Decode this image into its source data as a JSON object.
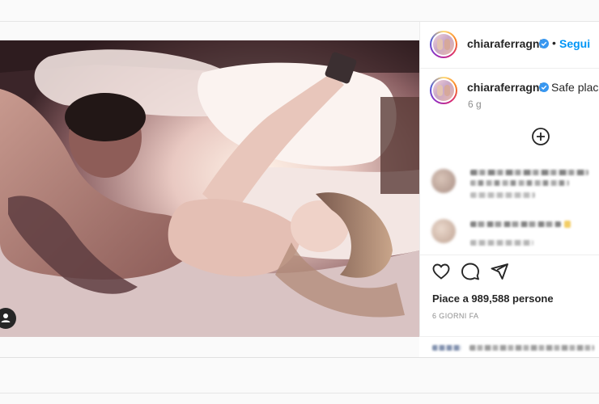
{
  "post": {
    "username": "chiaraferragni",
    "follow_label": "Segui",
    "dot": "•",
    "caption_user": "chiaraferragni",
    "caption_text": "Safe place",
    "caption_age": "6 g",
    "likes_text": "Piace a 989,588 persone",
    "date_text": "6 GIORNI FA"
  },
  "icons": {
    "verified": "verified-badge-icon",
    "load_more": "plus-circle-icon",
    "like": "heart-icon",
    "comment": "comment-bubble-icon",
    "share": "paper-plane-icon",
    "tags": "user-tag-icon"
  },
  "colors": {
    "accent": "#0095f6",
    "text": "#262626",
    "muted": "#8e8e8e",
    "border": "#efefef"
  }
}
